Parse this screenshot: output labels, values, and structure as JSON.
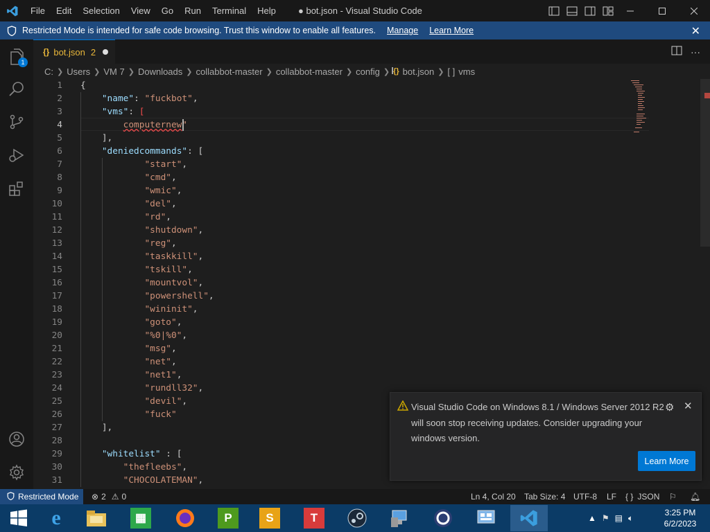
{
  "app": {
    "title": "● bot.json - Visual Studio Code",
    "accent": "#0078d4"
  },
  "menu": [
    "File",
    "Edit",
    "Selection",
    "View",
    "Go",
    "Run",
    "Terminal",
    "Help"
  ],
  "banner": {
    "message": "Restricted Mode is intended for safe code browsing. Trust this window to enable all features.",
    "manage": "Manage",
    "learn_more": "Learn More"
  },
  "activity": {
    "explorer_badge": "1"
  },
  "tab": {
    "icon": "{}",
    "name": "bot.json",
    "problems": "2"
  },
  "breadcrumb": [
    "C:",
    "Users",
    "VM 7",
    "Downloads",
    "collabbot-master",
    "collabbot-master",
    "config",
    "bot.json",
    "vms"
  ],
  "breadcrumb_icons": {
    "file": "{}",
    "array": "[ ]"
  },
  "editor": {
    "lines": [
      {
        "n": "1",
        "tokens": [
          [
            "p",
            "{"
          ]
        ]
      },
      {
        "n": "2",
        "tokens": [
          [
            "p",
            "    "
          ],
          [
            "k",
            "\"name\""
          ],
          [
            "p",
            ": "
          ],
          [
            "s",
            "\"fuckbot\""
          ],
          [
            "p",
            ","
          ]
        ]
      },
      {
        "n": "3",
        "tokens": [
          [
            "p",
            "    "
          ],
          [
            "k",
            "\"vms\""
          ],
          [
            "p",
            ": "
          ],
          [
            "err",
            "["
          ]
        ]
      },
      {
        "n": "4",
        "tokens": [
          [
            "p",
            "        "
          ],
          [
            "sq",
            "computernew"
          ],
          [
            "s",
            "\""
          ]
        ]
      },
      {
        "n": "5",
        "tokens": [
          [
            "p",
            "    ],"
          ]
        ]
      },
      {
        "n": "6",
        "tokens": [
          [
            "p",
            "    "
          ],
          [
            "k",
            "\"deniedcommands\""
          ],
          [
            "p",
            ": ["
          ]
        ]
      },
      {
        "n": "7",
        "tokens": [
          [
            "p",
            "            "
          ],
          [
            "s",
            "\"start\""
          ],
          [
            "p",
            ","
          ]
        ]
      },
      {
        "n": "8",
        "tokens": [
          [
            "p",
            "            "
          ],
          [
            "s",
            "\"cmd\""
          ],
          [
            "p",
            ","
          ]
        ]
      },
      {
        "n": "9",
        "tokens": [
          [
            "p",
            "            "
          ],
          [
            "s",
            "\"wmic\""
          ],
          [
            "p",
            ","
          ]
        ]
      },
      {
        "n": "10",
        "tokens": [
          [
            "p",
            "            "
          ],
          [
            "s",
            "\"del\""
          ],
          [
            "p",
            ","
          ]
        ]
      },
      {
        "n": "11",
        "tokens": [
          [
            "p",
            "            "
          ],
          [
            "s",
            "\"rd\""
          ],
          [
            "p",
            ","
          ]
        ]
      },
      {
        "n": "12",
        "tokens": [
          [
            "p",
            "            "
          ],
          [
            "s",
            "\"shutdown\""
          ],
          [
            "p",
            ","
          ]
        ]
      },
      {
        "n": "13",
        "tokens": [
          [
            "p",
            "            "
          ],
          [
            "s",
            "\"reg\""
          ],
          [
            "p",
            ","
          ]
        ]
      },
      {
        "n": "14",
        "tokens": [
          [
            "p",
            "            "
          ],
          [
            "s",
            "\"taskkill\""
          ],
          [
            "p",
            ","
          ]
        ]
      },
      {
        "n": "15",
        "tokens": [
          [
            "p",
            "            "
          ],
          [
            "s",
            "\"tskill\""
          ],
          [
            "p",
            ","
          ]
        ]
      },
      {
        "n": "16",
        "tokens": [
          [
            "p",
            "            "
          ],
          [
            "s",
            "\"mountvol\""
          ],
          [
            "p",
            ","
          ]
        ]
      },
      {
        "n": "17",
        "tokens": [
          [
            "p",
            "            "
          ],
          [
            "s",
            "\"powershell\""
          ],
          [
            "p",
            ","
          ]
        ]
      },
      {
        "n": "18",
        "tokens": [
          [
            "p",
            "            "
          ],
          [
            "s",
            "\"wininit\""
          ],
          [
            "p",
            ","
          ]
        ]
      },
      {
        "n": "19",
        "tokens": [
          [
            "p",
            "            "
          ],
          [
            "s",
            "\"goto\""
          ],
          [
            "p",
            ","
          ]
        ]
      },
      {
        "n": "20",
        "tokens": [
          [
            "p",
            "            "
          ],
          [
            "s",
            "\"%0|%0\""
          ],
          [
            "p",
            ","
          ]
        ]
      },
      {
        "n": "21",
        "tokens": [
          [
            "p",
            "            "
          ],
          [
            "s",
            "\"msg\""
          ],
          [
            "p",
            ","
          ]
        ]
      },
      {
        "n": "22",
        "tokens": [
          [
            "p",
            "            "
          ],
          [
            "s",
            "\"net\""
          ],
          [
            "p",
            ","
          ]
        ]
      },
      {
        "n": "23",
        "tokens": [
          [
            "p",
            "            "
          ],
          [
            "s",
            "\"net1\""
          ],
          [
            "p",
            ","
          ]
        ]
      },
      {
        "n": "24",
        "tokens": [
          [
            "p",
            "            "
          ],
          [
            "s",
            "\"rundll32\""
          ],
          [
            "p",
            ","
          ]
        ]
      },
      {
        "n": "25",
        "tokens": [
          [
            "p",
            "            "
          ],
          [
            "s",
            "\"devil\""
          ],
          [
            "p",
            ","
          ]
        ]
      },
      {
        "n": "26",
        "tokens": [
          [
            "p",
            "            "
          ],
          [
            "s",
            "\"fuck\""
          ]
        ]
      },
      {
        "n": "27",
        "tokens": [
          [
            "p",
            "    ],"
          ]
        ]
      },
      {
        "n": "28",
        "tokens": []
      },
      {
        "n": "29",
        "tokens": [
          [
            "p",
            "    "
          ],
          [
            "k",
            "\"whitelist\""
          ],
          [
            "p",
            " : ["
          ]
        ]
      },
      {
        "n": "30",
        "tokens": [
          [
            "p",
            "        "
          ],
          [
            "s",
            "\"thefleebs\""
          ],
          [
            "p",
            ","
          ]
        ]
      },
      {
        "n": "31",
        "tokens": [
          [
            "p",
            "        "
          ],
          [
            "s",
            "\"CHOCOLATEMAN\""
          ],
          [
            "p",
            ","
          ]
        ]
      }
    ],
    "current_line": "4"
  },
  "notification": {
    "message": "Visual Studio Code on Windows 8.1 / Windows Server 2012 R2 will soon stop receiving updates. Consider upgrading your windows version.",
    "button": "Learn More"
  },
  "status": {
    "restricted": "Restricted Mode",
    "errors": "2",
    "warnings": "0",
    "position": "Ln 4, Col 20",
    "tab_size": "Tab Size: 4",
    "encoding": "UTF-8",
    "eol": "LF",
    "language_icon": "{ }",
    "language": "JSON"
  },
  "taskbar": {
    "apps": [
      "start-button",
      "internet-explorer",
      "file-explorer",
      "store",
      "firefox",
      "publisher",
      "sway",
      "todo",
      "steam",
      "remote-desktop",
      "cinema4d",
      "control-panel",
      "vscode"
    ],
    "time": "3:25 PM",
    "date": "6/2/2023"
  }
}
